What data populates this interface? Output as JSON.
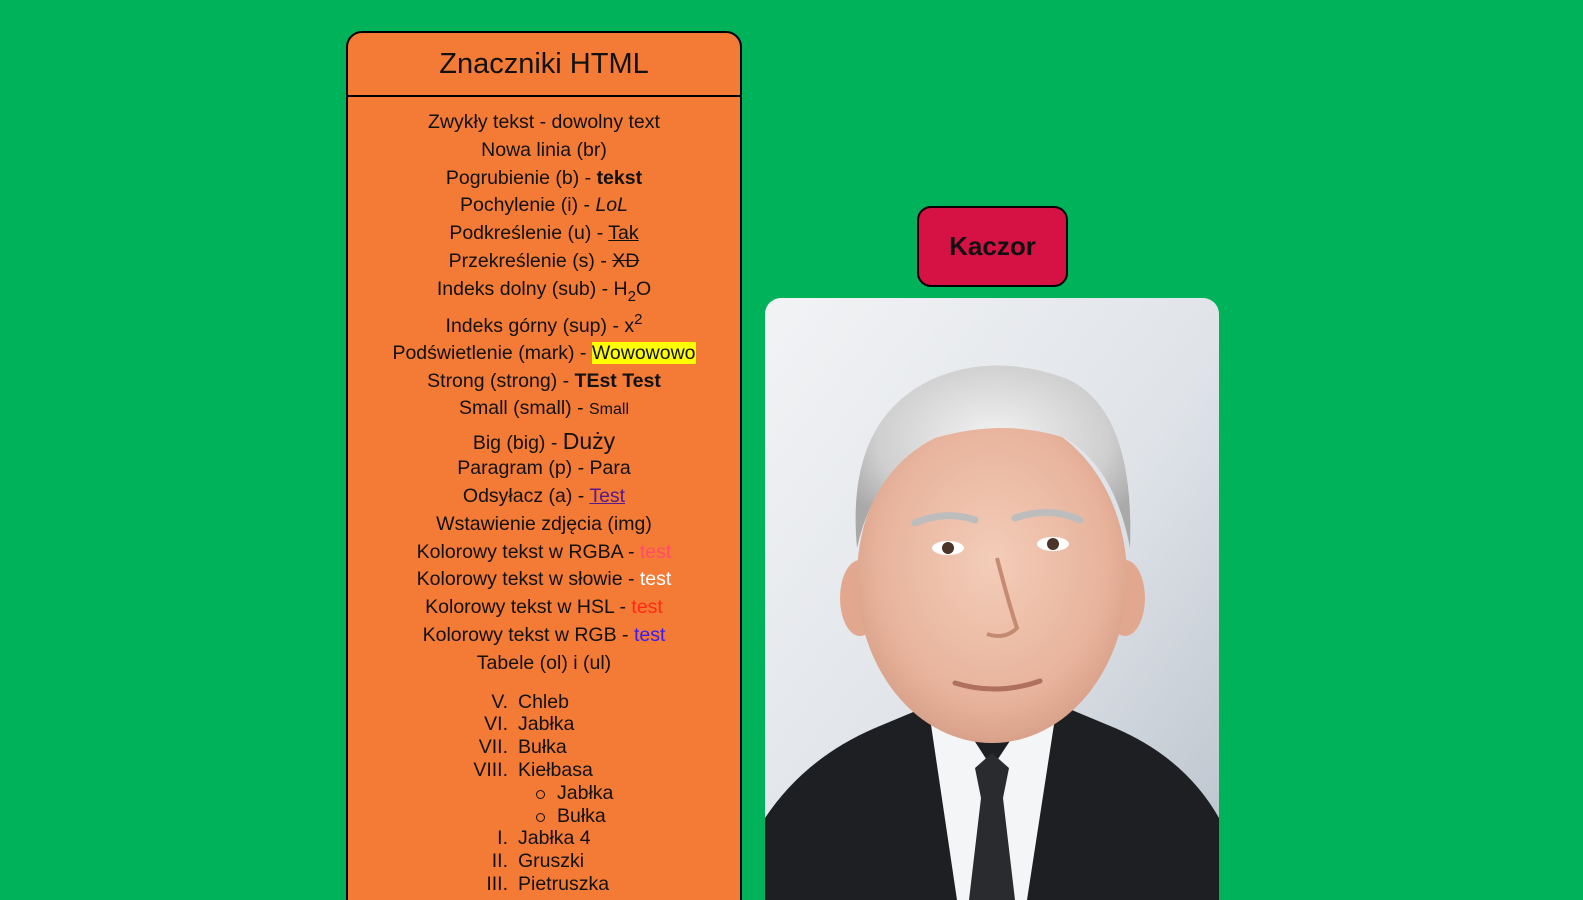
{
  "panel": {
    "title": "Znaczniki HTML",
    "rows": {
      "plain": {
        "label": "Zwykły tekst - ",
        "value": "dowolny text"
      },
      "br": {
        "label": "Nowa linia (br)"
      },
      "bold": {
        "label": "Pogrubienie (b) - ",
        "value": "tekst"
      },
      "italic": {
        "label": "Pochylenie (i) - ",
        "value": "LoL"
      },
      "underline": {
        "label": "Podkreślenie (u) - ",
        "value": "Tak"
      },
      "strike": {
        "label": "Przekreślenie (s) - ",
        "value": "XD"
      },
      "sub": {
        "label": "Indeks dolny (sub) - ",
        "base": "H",
        "index": "2",
        "tail": "O"
      },
      "sup": {
        "label": "Indeks górny (sup) - ",
        "base": "x",
        "index": "2"
      },
      "mark": {
        "label": "Podświetlenie (mark) - ",
        "value": "Wowowowo"
      },
      "strong": {
        "label": "Strong (strong) - ",
        "value": "TEst Test"
      },
      "small": {
        "label": "Small (small) - ",
        "value": "Small"
      },
      "big": {
        "label": "Big (big) - ",
        "value": "Duży"
      },
      "paragraph": {
        "label": "Paragram (p) - ",
        "value": "Para"
      },
      "anchor": {
        "label": "Odsyłacz (a) - ",
        "value": "Test"
      },
      "img": {
        "label": "Wstawienie zdjęcia (img)"
      },
      "rgba": {
        "label": "Kolorowy tekst w RGBA - ",
        "value": "test"
      },
      "word": {
        "label": "Kolorowy tekst w słowie - ",
        "value": "test"
      },
      "hsl": {
        "label": "Kolorowy tekst w HSL - ",
        "value": "test"
      },
      "rgb": {
        "label": "Kolorowy tekst w RGB - ",
        "value": "test"
      },
      "lists": {
        "label": "Tabele (ol) i (ul)"
      }
    },
    "ordered_list": [
      {
        "num": "V.",
        "text": "Chleb"
      },
      {
        "num": "VI.",
        "text": "Jabłka"
      },
      {
        "num": "VII.",
        "text": "Bułka"
      },
      {
        "num": "VIII.",
        "text": "Kiełbasa"
      }
    ],
    "nested_list": [
      "Jabłka",
      "Bułka"
    ],
    "second_list": [
      {
        "num": "I.",
        "text": "Jabłka 4"
      },
      {
        "num": "II.",
        "text": "Gruszki"
      },
      {
        "num": "III.",
        "text": "Pietruszka"
      }
    ]
  },
  "button": {
    "label": "Kaczor"
  },
  "colors": {
    "background": "#00b25a",
    "panel": "#f47b35",
    "button": "#d61245",
    "highlight": "#ffff00",
    "link": "#551a8b"
  },
  "photo": {
    "icon": "portrait-photo"
  }
}
